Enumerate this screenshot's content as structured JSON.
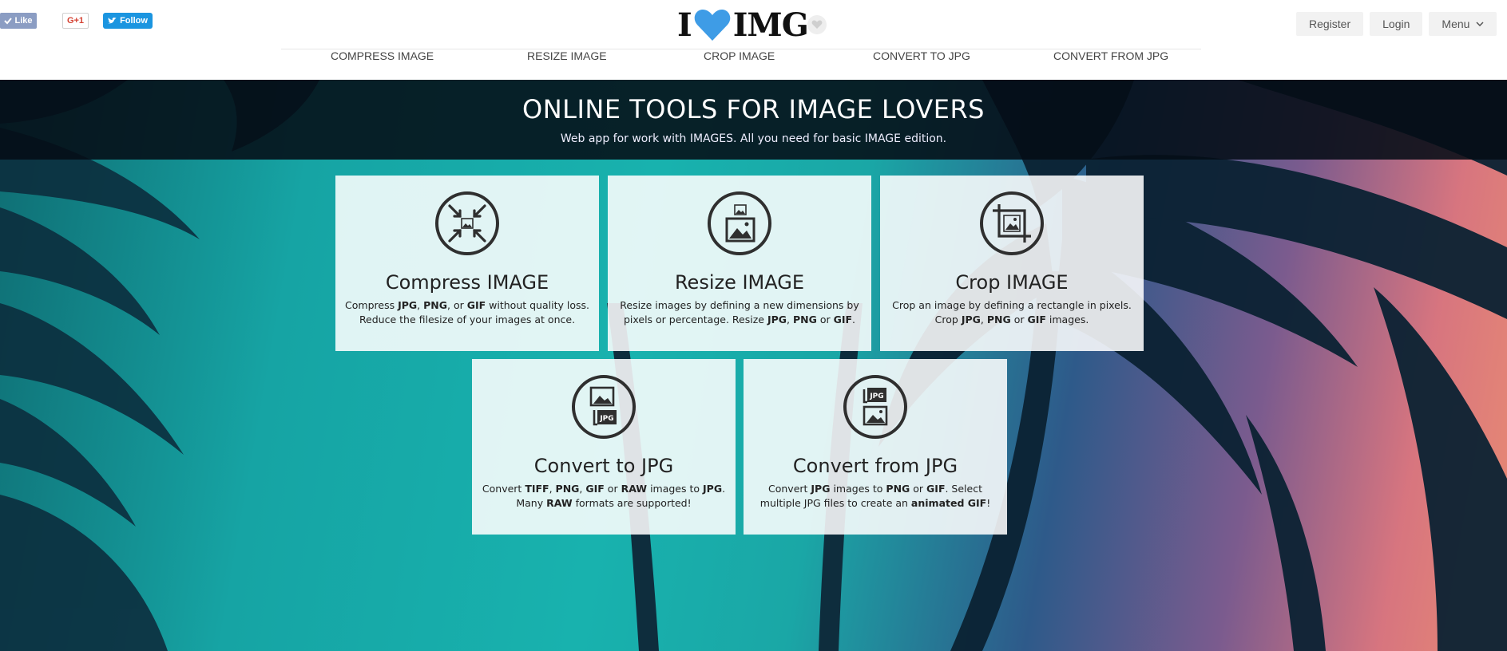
{
  "social": {
    "like_label": "Like",
    "gplus_label": "G+1",
    "follow_label": "Follow"
  },
  "logo": {
    "left_text": "I",
    "right_text": "IMG"
  },
  "top_right": {
    "register_label": "Register",
    "login_label": "Login",
    "menu_label": "Menu"
  },
  "nav": {
    "items": [
      {
        "label": "COMPRESS IMAGE"
      },
      {
        "label": "RESIZE IMAGE"
      },
      {
        "label": "CROP IMAGE"
      },
      {
        "label": "CONVERT TO JPG"
      },
      {
        "label": "CONVERT FROM JPG"
      }
    ]
  },
  "hero": {
    "title": "ONLINE TOOLS FOR IMAGE LOVERS",
    "subtitle": "Web app for work with IMAGES. All you need for basic IMAGE edition."
  },
  "cards": [
    {
      "title": "Compress IMAGE",
      "icon": "compress-icon",
      "desc": [
        {
          "t": "Compress "
        },
        {
          "t": "JPG",
          "b": true
        },
        {
          "t": ", "
        },
        {
          "t": "PNG",
          "b": true
        },
        {
          "t": ", or "
        },
        {
          "t": "GIF",
          "b": true
        },
        {
          "t": " without quality loss. Reduce the filesize of your images at once."
        }
      ]
    },
    {
      "title": "Resize IMAGE",
      "icon": "resize-icon",
      "desc": [
        {
          "t": "Resize images by defining a new dimensions by pixels or percentage. Resize "
        },
        {
          "t": "JPG",
          "b": true
        },
        {
          "t": ", "
        },
        {
          "t": "PNG",
          "b": true
        },
        {
          "t": " or "
        },
        {
          "t": "GIF",
          "b": true
        },
        {
          "t": "."
        }
      ]
    },
    {
      "title": "Crop IMAGE",
      "icon": "crop-icon",
      "desc": [
        {
          "t": "Crop an image by defining a rectangle in pixels. Crop "
        },
        {
          "t": "JPG",
          "b": true
        },
        {
          "t": ", "
        },
        {
          "t": "PNG",
          "b": true
        },
        {
          "t": " or "
        },
        {
          "t": "GIF",
          "b": true
        },
        {
          "t": " images."
        }
      ]
    },
    {
      "title": "Convert to JPG",
      "icon": "convert-to-jpg-icon",
      "icon_badge": "JPG",
      "desc": [
        {
          "t": "Convert "
        },
        {
          "t": "TIFF",
          "b": true
        },
        {
          "t": ", "
        },
        {
          "t": "PNG",
          "b": true
        },
        {
          "t": ", "
        },
        {
          "t": "GIF",
          "b": true
        },
        {
          "t": " or "
        },
        {
          "t": "RAW",
          "b": true
        },
        {
          "t": " images to "
        },
        {
          "t": "JPG",
          "b": true
        },
        {
          "t": ". Many "
        },
        {
          "t": "RAW",
          "b": true
        },
        {
          "t": " formats are supported!"
        }
      ]
    },
    {
      "title": "Convert from JPG",
      "icon": "convert-from-jpg-icon",
      "icon_badge": "JPG",
      "desc": [
        {
          "t": "Convert "
        },
        {
          "t": "JPG",
          "b": true
        },
        {
          "t": " images to "
        },
        {
          "t": "PNG",
          "b": true
        },
        {
          "t": " or "
        },
        {
          "t": "GIF",
          "b": true
        },
        {
          "t": ". Select multiple JPG files to create an "
        },
        {
          "t": "animated GIF",
          "b": true
        },
        {
          "t": "!"
        }
      ]
    }
  ],
  "colors": {
    "accent_blue": "#3e9ce6",
    "like_bg": "#8b9dc3",
    "follow_bg": "#1b95e0",
    "band_dark": "#040c16"
  }
}
